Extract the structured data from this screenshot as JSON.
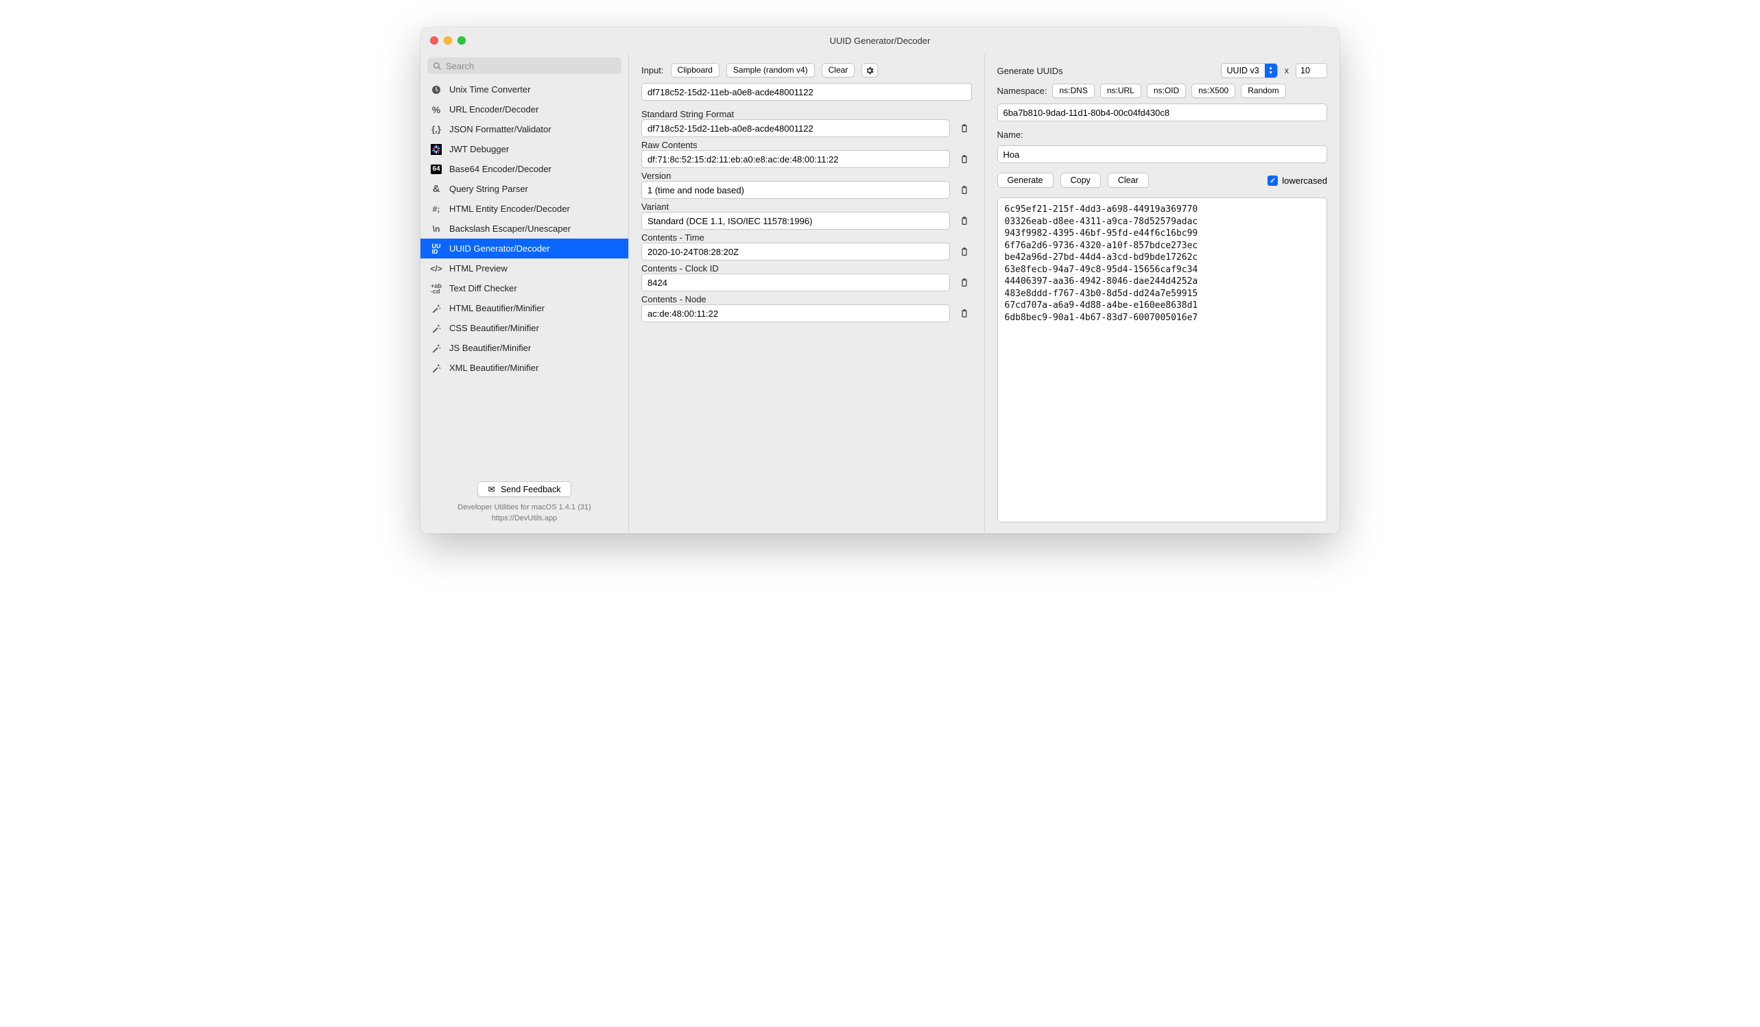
{
  "window": {
    "title": "UUID Generator/Decoder"
  },
  "sidebar": {
    "search_placeholder": "Search",
    "items": [
      {
        "label": "Unix Time Converter",
        "icon": "clock"
      },
      {
        "label": "URL Encoder/Decoder",
        "icon": "percent"
      },
      {
        "label": "JSON Formatter/Validator",
        "icon": "braces"
      },
      {
        "label": "JWT Debugger",
        "icon": "jwt"
      },
      {
        "label": "Base64 Encoder/Decoder",
        "icon": "b64"
      },
      {
        "label": "Query String Parser",
        "icon": "amp"
      },
      {
        "label": "HTML Entity Encoder/Decoder",
        "icon": "hash"
      },
      {
        "label": "Backslash Escaper/Unescaper",
        "icon": "bslash"
      },
      {
        "label": "UUID Generator/Decoder",
        "icon": "uuid",
        "selected": true
      },
      {
        "label": "HTML Preview",
        "icon": "angle"
      },
      {
        "label": "Text Diff Checker",
        "icon": "diff"
      },
      {
        "label": "HTML Beautifier/Minifier",
        "icon": "wand"
      },
      {
        "label": "CSS Beautifier/Minifier",
        "icon": "wand"
      },
      {
        "label": "JS Beautifier/Minifier",
        "icon": "wand"
      },
      {
        "label": "XML Beautifier/Minifier",
        "icon": "wand"
      }
    ],
    "feedback_label": "Send Feedback",
    "meta_line1": "Developer Utilities for macOS 1.4.1 (31)",
    "meta_line2": "https://DevUtils.app"
  },
  "decoder": {
    "input_label": "Input:",
    "clipboard_btn": "Clipboard",
    "sample_btn": "Sample (random v4)",
    "clear_btn": "Clear",
    "input_value": "df718c52-15d2-11eb-a0e8-acde48001122",
    "fields": [
      {
        "name": "Standard String Format",
        "value": "df718c52-15d2-11eb-a0e8-acde48001122"
      },
      {
        "name": "Raw Contents",
        "value": "df:71:8c:52:15:d2:11:eb:a0:e8:ac:de:48:00:11:22"
      },
      {
        "name": "Version",
        "value": "1 (time and node based)"
      },
      {
        "name": "Variant",
        "value": "Standard (DCE 1.1, ISO/IEC 11578:1996)"
      },
      {
        "name": "Contents - Time",
        "value": "2020-10-24T08:28:20Z"
      },
      {
        "name": "Contents - Clock ID",
        "value": "8424"
      },
      {
        "name": "Contents - Node",
        "value": "ac:de:48:00:11:22"
      }
    ]
  },
  "generator": {
    "title": "Generate UUIDs",
    "version_select": "UUID v3",
    "x_label": "x",
    "count": "10",
    "namespace_label": "Namespace:",
    "namespace_buttons": [
      "ns:DNS",
      "ns:URL",
      "ns:OID",
      "ns:X500",
      "Random"
    ],
    "namespace_value": "6ba7b810-9dad-11d1-80b4-00c04fd430c8",
    "name_label": "Name:",
    "name_value": "Hoa",
    "generate_btn": "Generate",
    "copy_btn": "Copy",
    "clear_btn": "Clear",
    "lowercased_label": "lowercased",
    "lowercased_checked": true,
    "output_lines": [
      "6c95ef21-215f-4dd3-a698-44919a369770",
      "03326eab-d8ee-4311-a9ca-78d52579adac",
      "943f9982-4395-46bf-95fd-e44f6c16bc99",
      "6f76a2d6-9736-4320-a10f-857bdce273ec",
      "be42a96d-27bd-44d4-a3cd-bd9bde17262c",
      "63e8fecb-94a7-49c8-95d4-15656caf9c34",
      "44406397-aa36-4942-8046-dae244d4252a",
      "483e8ddd-f767-43b0-8d5d-dd24a7e59915",
      "67cd707a-a6a9-4d88-a4be-e160ee8638d1",
      "6db8bec9-90a1-4b67-83d7-6007005016e7"
    ]
  }
}
